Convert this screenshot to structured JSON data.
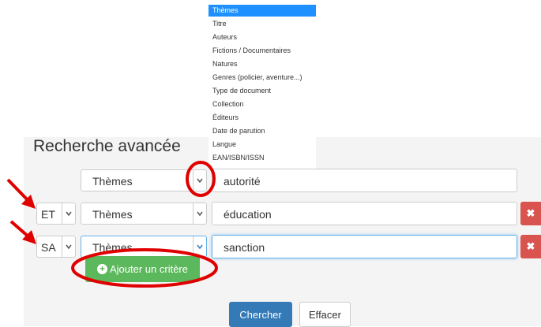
{
  "search": {
    "title": "Recherche avancée",
    "dropdown_options": [
      "Thèmes",
      "Titre",
      "Auteurs",
      "Fictions / Documentaires",
      "Natures",
      "Genres (policier, aventure...)",
      "Type de document",
      "Collection",
      "Éditeurs",
      "Date de parution",
      "Langue",
      "EAN/ISBN/ISSN"
    ],
    "rows": [
      {
        "operator": "",
        "field": "Thèmes",
        "value": "autorité"
      },
      {
        "operator": "ET",
        "field": "Thèmes",
        "value": "éducation"
      },
      {
        "operator": "SA",
        "field": "Thèmes",
        "value": "sanction"
      }
    ],
    "add_criteria_label": "Ajouter un critère",
    "search_label": "Chercher",
    "clear_label": "Effacer",
    "delete_symbol": "✖"
  },
  "colors": {
    "annotation_red": "#e00000",
    "primary_blue": "#337ab7",
    "success_green": "#5cb85c",
    "danger_red": "#d9534f",
    "highlight_blue": "#1e90ff"
  },
  "icons": {
    "chevron": "chevron-down-icon",
    "add": "plus-circle-icon",
    "delete": "close-icon",
    "annotation": "red-arrow-icon"
  }
}
